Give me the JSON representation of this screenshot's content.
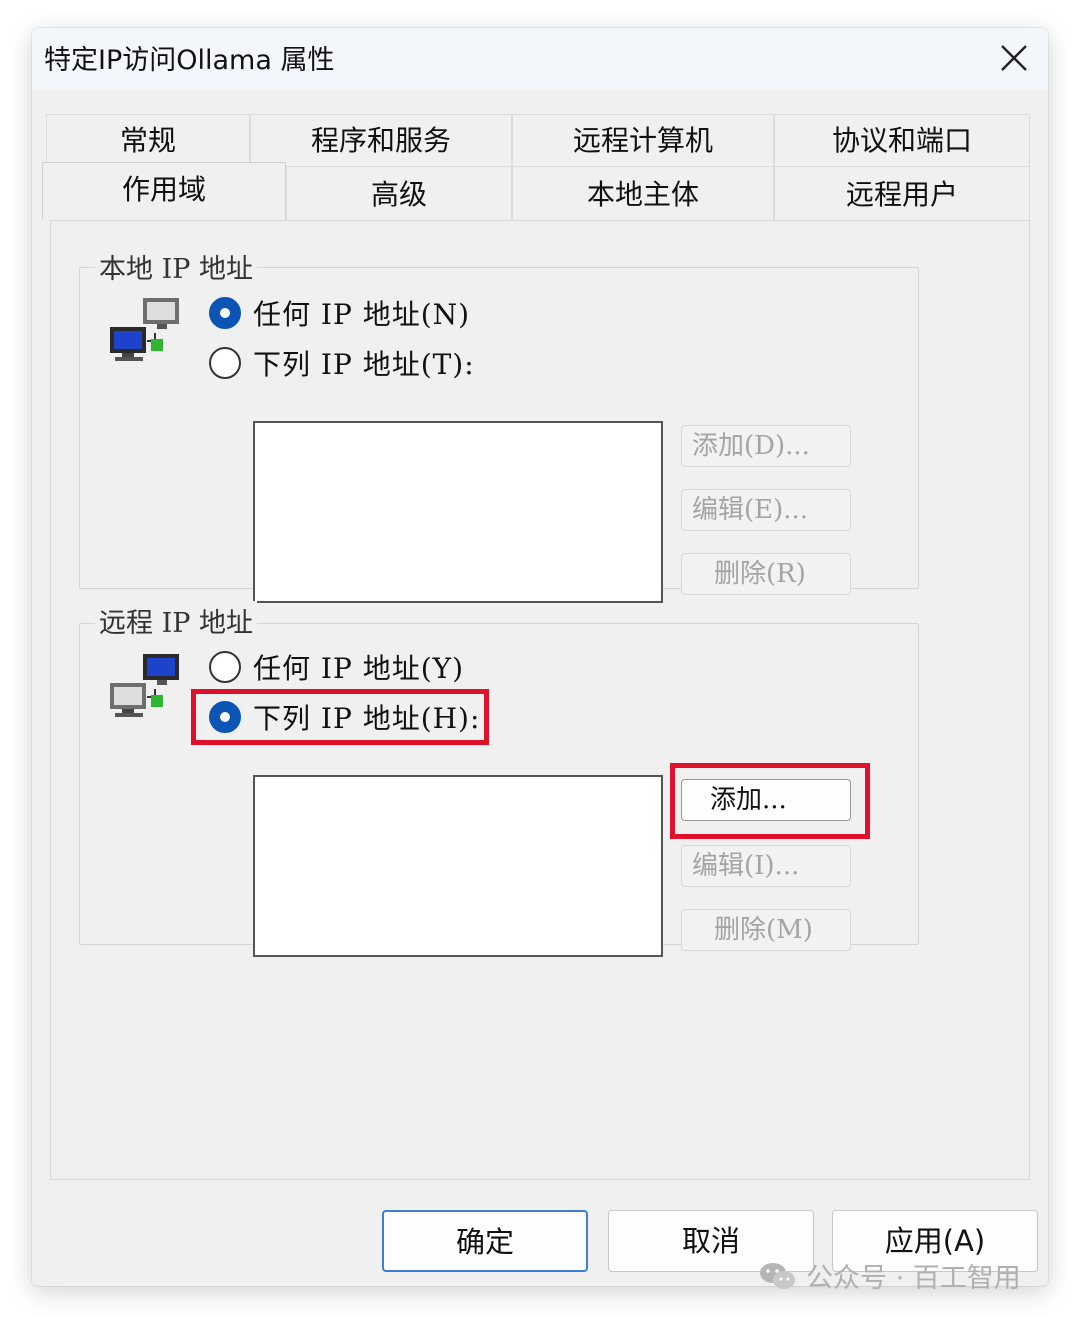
{
  "window": {
    "title": "特定IP访问Ollama 属性"
  },
  "tabs": {
    "row1": [
      "常规",
      "程序和服务",
      "远程计算机",
      "协议和端口"
    ],
    "row2": [
      "作用域",
      "高级",
      "本地主体",
      "远程用户"
    ],
    "active": "作用域"
  },
  "local_ip": {
    "legend": "本地 IP 地址",
    "option_any": "任何 IP 地址(N)",
    "option_list": "下列 IP 地址(T):",
    "selected": "any",
    "buttons": {
      "add": "添加(D)...",
      "edit": "编辑(E)...",
      "delete": "删除(R)"
    }
  },
  "remote_ip": {
    "legend": "远程 IP 地址",
    "option_any": "任何 IP 地址(Y)",
    "option_list": "下列 IP 地址(H):",
    "selected": "list",
    "buttons": {
      "add": "添加...",
      "edit": "编辑(I)...",
      "delete": "删除(M)"
    }
  },
  "footer": {
    "ok": "确定",
    "cancel": "取消",
    "apply": "应用(A)"
  },
  "watermark": {
    "text": "公众号 · 百工智用"
  },
  "colors": {
    "highlight": "#e0112b",
    "radio_checked": "#0c55b5",
    "default_button_border": "#3f7fd3"
  }
}
